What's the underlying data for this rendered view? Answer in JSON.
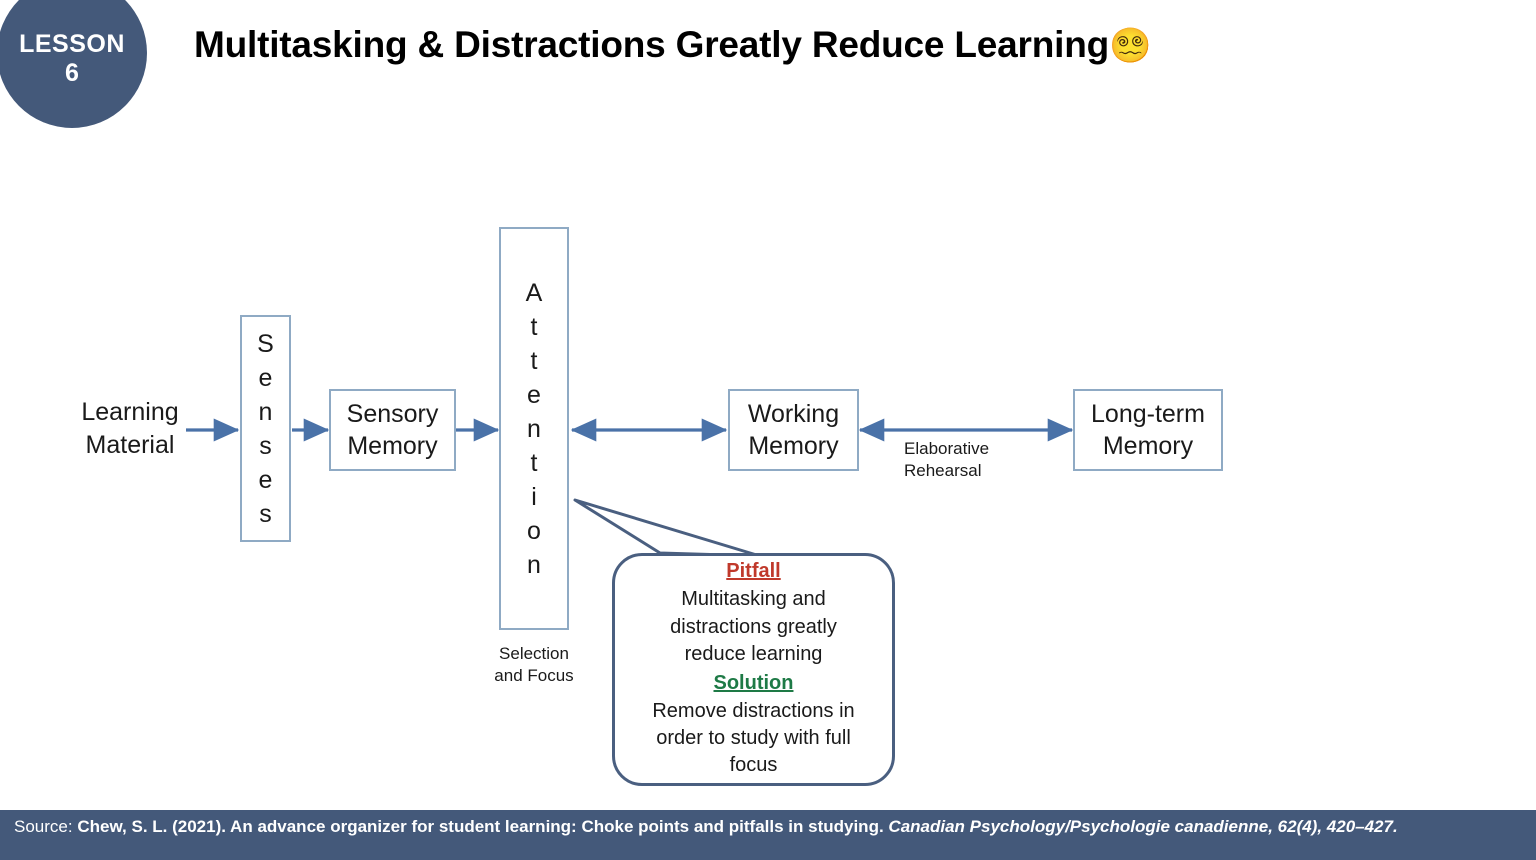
{
  "badge": {
    "word": "LESSON",
    "number": "6",
    "color": "#44597a"
  },
  "title": {
    "text": "Multitasking & Distractions Greatly Reduce Learning",
    "emoji": "😵‍💫"
  },
  "diagram": {
    "input_label": "Learning\nMaterial",
    "input_line1": "Learning",
    "input_line2": "Material",
    "senses": {
      "label": "Senses",
      "letters": [
        "S",
        "e",
        "n",
        "s",
        "e",
        "s"
      ]
    },
    "sensory_memory": {
      "line1": "Sensory",
      "line2": "Memory"
    },
    "attention": {
      "label": "Attention",
      "letters": [
        "A",
        "t",
        "t",
        "e",
        "n",
        "t",
        "i",
        "o",
        "n"
      ],
      "caption_line1": "Selection",
      "caption_line2": "and Focus"
    },
    "working_memory": {
      "line1": "Working",
      "line2": "Memory"
    },
    "long_term_memory": {
      "line1": "Long-term",
      "line2": "Memory"
    },
    "rehearsal": {
      "line1": "Elaborative",
      "line2": "Rehearsal"
    },
    "box_border_color": "#8faac4",
    "arrow_color": "#4a72a8"
  },
  "callout": {
    "pitfall_heading": "Pitfall",
    "pitfall_lines": [
      "Multitasking and",
      "distractions greatly",
      "reduce learning"
    ],
    "solution_heading": "Solution",
    "solution_lines": [
      "Remove distractions in",
      "order to study with full",
      "focus"
    ],
    "pitfall_color": "#c0392b",
    "solution_color": "#1e7a46",
    "border_color": "#4a5f80"
  },
  "source": {
    "label": "Source:",
    "reference": "Chew, S. L. (2021). An advance organizer for student learning: Choke points and pitfalls in studying.",
    "journal": "Canadian Psychology/Psychologie canadienne, 62",
    "volume_rest": "(4), 420–427.",
    "bar_color": "#44597a"
  }
}
